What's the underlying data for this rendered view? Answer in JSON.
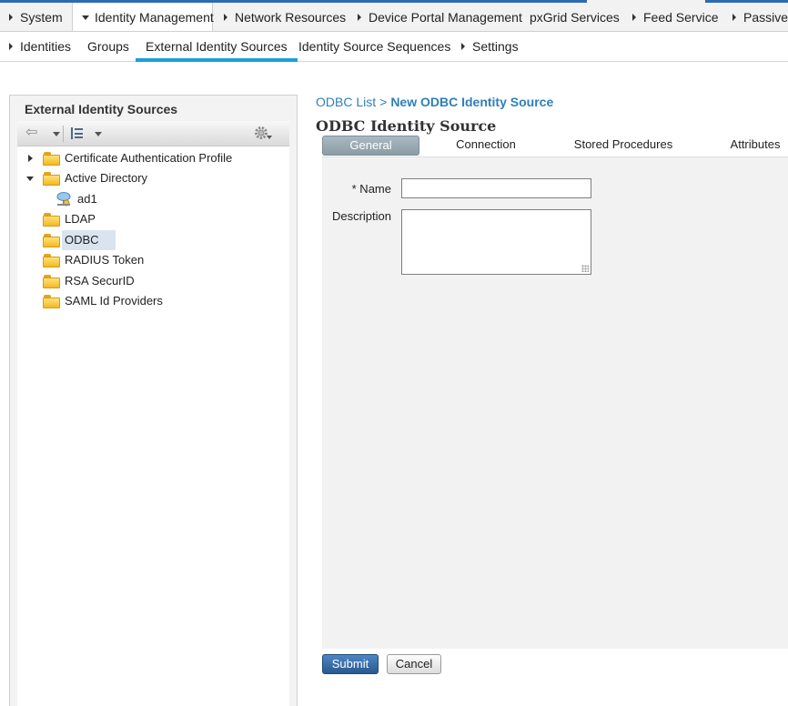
{
  "topnav": {
    "items": [
      {
        "label": "System",
        "active": false,
        "expanded": false
      },
      {
        "label": "Identity Management",
        "active": true,
        "expanded": true
      },
      {
        "label": "Network Resources",
        "active": false,
        "expanded": false
      },
      {
        "label": "Device Portal Management",
        "active": false,
        "expanded": false
      },
      {
        "label": "pxGrid Services",
        "active": false,
        "expanded": false
      },
      {
        "label": "Feed Service",
        "active": false,
        "expanded": false
      },
      {
        "label": "Passivel",
        "active": false,
        "expanded": false
      }
    ]
  },
  "subnav": {
    "items": [
      {
        "label": "Identities",
        "has_menu": true
      },
      {
        "label": "Groups",
        "has_menu": false
      },
      {
        "label": "External Identity Sources",
        "has_menu": false,
        "active": true
      },
      {
        "label": "Identity Source Sequences",
        "has_menu": false
      },
      {
        "label": "Settings",
        "has_menu": true
      }
    ]
  },
  "leftpanel": {
    "title": "External Identity Sources",
    "tree": [
      {
        "label": "Certificate Authentication Profile",
        "expander": "collapsed",
        "icon": "folder-icon"
      },
      {
        "label": "Active Directory",
        "expander": "expanded",
        "icon": "folder-icon"
      },
      {
        "label": "ad1",
        "expander": "none",
        "icon": "directory-node-icon",
        "child": true
      },
      {
        "label": "LDAP",
        "expander": "none",
        "icon": "folder-icon"
      },
      {
        "label": "ODBC",
        "expander": "none",
        "icon": "folder-icon",
        "selected": true
      },
      {
        "label": "RADIUS Token",
        "expander": "none",
        "icon": "folder-icon"
      },
      {
        "label": "RSA SecurID",
        "expander": "none",
        "icon": "folder-icon"
      },
      {
        "label": "SAML Id Providers",
        "expander": "none",
        "icon": "folder-icon"
      }
    ]
  },
  "breadcrumb": {
    "parent": "ODBC List",
    "separator": ">",
    "current": "New ODBC Identity Source"
  },
  "content": {
    "title": "ODBC Identity Source",
    "tabs": [
      {
        "label": "General",
        "active": true
      },
      {
        "label": "Connection",
        "active": false
      },
      {
        "label": "Stored Procedures",
        "active": false
      },
      {
        "label": "Attributes",
        "active": false
      }
    ],
    "form": {
      "name_label": "* Name",
      "name_value": "",
      "description_label": "Description",
      "description_value": ""
    },
    "submit_label": "Submit",
    "cancel_label": "Cancel"
  },
  "colors": {
    "accent_blue": "#2d6ab3",
    "tab_underline": "#1ba0d7",
    "link": "#2f7fb8",
    "selected_row": "#d9e4ef"
  }
}
